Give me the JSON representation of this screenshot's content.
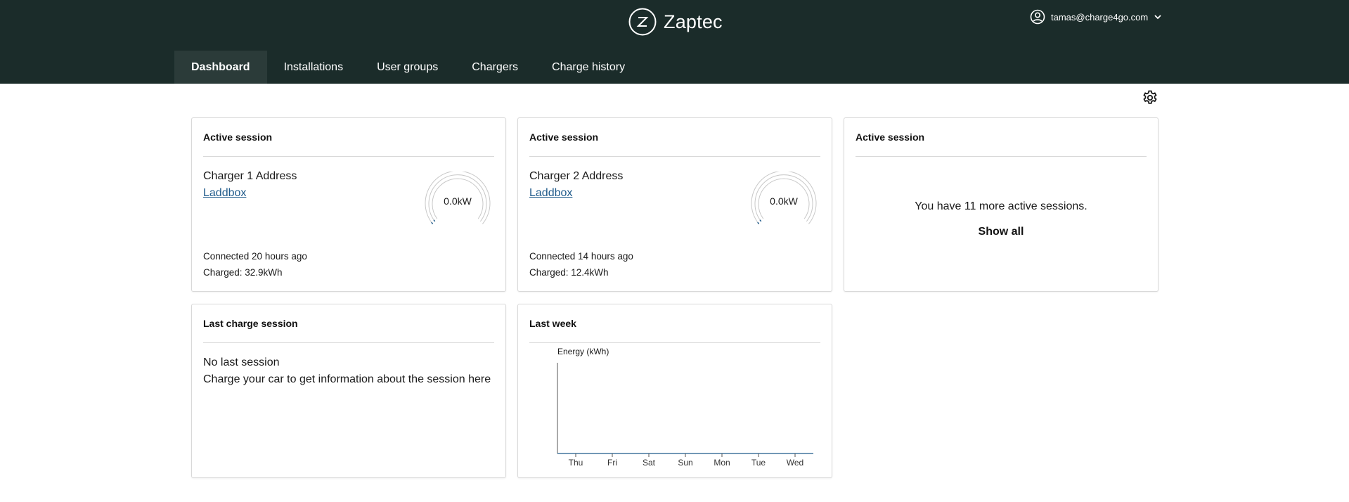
{
  "app": {
    "brand": "Zaptec"
  },
  "user": {
    "email": "tamas@charge4go.com"
  },
  "nav": {
    "tabs": [
      {
        "label": "Dashboard",
        "active": true
      },
      {
        "label": "Installations"
      },
      {
        "label": "User groups"
      },
      {
        "label": "Chargers"
      },
      {
        "label": "Charge history"
      }
    ]
  },
  "sessions": [
    {
      "title": "Active session",
      "charger": "Charger 1 Address",
      "model": "Laddbox",
      "power": "0.0kW",
      "connected": "Connected 20 hours ago",
      "charged": "Charged: 32.9kWh"
    },
    {
      "title": "Active session",
      "charger": "Charger 2 Address",
      "model": "Laddbox",
      "power": "0.0kW",
      "connected": "Connected 14 hours ago",
      "charged": "Charged: 12.4kWh"
    }
  ],
  "more_sessions": {
    "title": "Active session",
    "text": "You have 11 more active sessions.",
    "action": "Show all"
  },
  "last_charge": {
    "title": "Last charge session",
    "heading": "No last session",
    "text": "Charge your car to get information about the session here"
  },
  "last_week": {
    "title": "Last week"
  },
  "chart_data": {
    "type": "bar",
    "ylabel": "Energy (kWh)",
    "categories": [
      "Thu",
      "Fri",
      "Sat",
      "Sun",
      "Mon",
      "Tue",
      "Wed"
    ],
    "values": [
      0,
      0,
      0,
      0,
      0,
      0,
      0
    ],
    "ylim": [
      0,
      1
    ],
    "grid": false,
    "legend": "none",
    "color": "#1f5a8a"
  },
  "colors": {
    "header_bg": "#1b2c2a",
    "active_tab_bg": "#2b3b39",
    "link": "#1f5a8a"
  }
}
